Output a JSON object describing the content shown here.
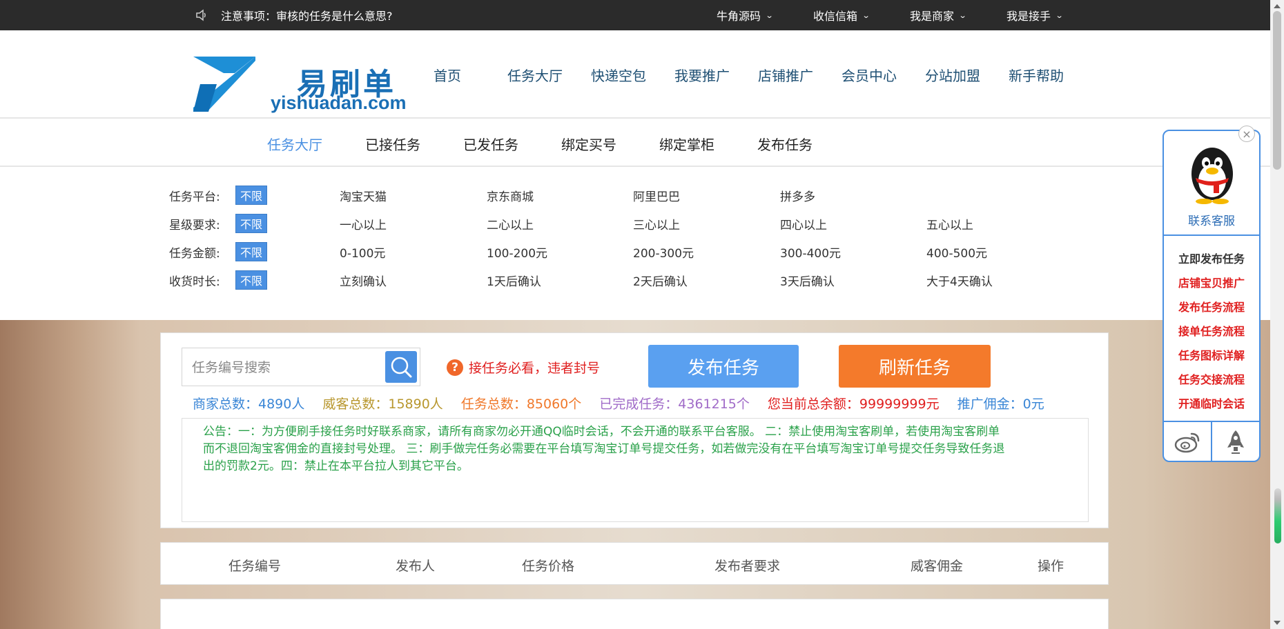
{
  "topbar": {
    "notice": "注意事项：审核的任务是什么意思?",
    "menus": [
      "牛角源码",
      "收信信箱",
      "我是商家",
      "我是接手"
    ]
  },
  "logo": {
    "cn": "易刷单",
    "en": "yishuadan.com"
  },
  "main_nav": [
    "首页",
    "任务大厅",
    "快递空包",
    "我要推广",
    "店铺推广",
    "会员中心",
    "分站加盟",
    "新手帮助"
  ],
  "sub_nav": {
    "items": [
      "任务大厅",
      "已接任务",
      "已发任务",
      "绑定买号",
      "绑定掌柜",
      "发布任务"
    ],
    "active": "任务大厅"
  },
  "filters": [
    {
      "label": "任务平台:",
      "all": "不限",
      "options": [
        "淘宝天猫",
        "京东商城",
        "阿里巴巴",
        "拼多多"
      ]
    },
    {
      "label": "星级要求:",
      "all": "不限",
      "options": [
        "一心以上",
        "二心以上",
        "三心以上",
        "四心以上",
        "五心以上"
      ]
    },
    {
      "label": "任务金额:",
      "all": "不限",
      "options": [
        "0-100元",
        "100-200元",
        "200-300元",
        "300-400元",
        "400-500元"
      ]
    },
    {
      "label": "收货时长:",
      "all": "不限",
      "options": [
        "立刻确认",
        "1天后确认",
        "2天后确认",
        "3天后确认",
        "大于4天确认"
      ]
    }
  ],
  "search": {
    "placeholder": "任务编号搜索"
  },
  "warning": "接任务必看，违者封号",
  "buttons": {
    "publish": "发布任务",
    "refresh": "刷新任务"
  },
  "stats": {
    "merchants": "商家总数：4890人",
    "weike": "威客总数：15890人",
    "tasks": "任务总数：85060个",
    "done": "已完成任务：4361215个",
    "balance": "您当前总余额：99999999元",
    "promo": "推广佣金：0元"
  },
  "announcement": "公告：一：为方便刷手接任务时好联系商家，请所有商家勿必开通QQ临时会话，不会开通的联系平台客服。 二：禁止使用淘宝客刷单，若使用淘宝客刷单而不退回淘宝客佣金的直接封号处理。 三：刷手做完任务必需要在平台填写淘宝订单号提交任务，如若做完没有在平台填写淘宝订单号提交任务导致任务退出的罚款2元。四：禁止在本平台拉人到其它平台。",
  "table": {
    "headers": [
      "任务编号",
      "发布人",
      "任务价格",
      "发布者要求",
      "威客佣金",
      "操作"
    ]
  },
  "float_widget": {
    "service": "联系客服",
    "links": [
      "立即发布任务",
      "店铺宝贝推广",
      "发布任务流程",
      "接单任务流程",
      "任务图标详解",
      "任务交接流程",
      "开通临时会话"
    ]
  },
  "colors": {
    "accent": "#4a90e2",
    "orange": "#f47a2b",
    "red": "#e02020",
    "green": "#2aa14a"
  }
}
